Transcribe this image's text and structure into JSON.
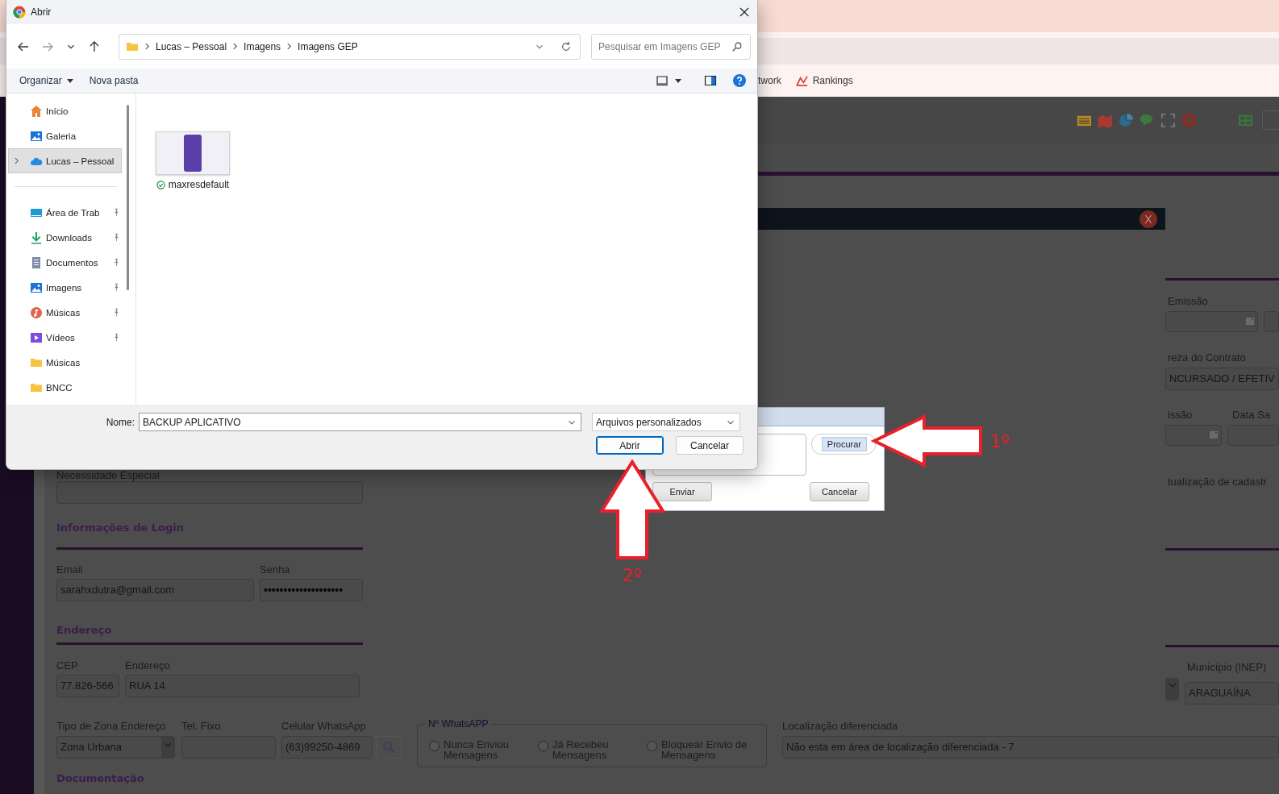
{
  "browser": {
    "bookmarks": [
      {
        "label": "twork",
        "kind": "plain"
      },
      {
        "label": "Rankings",
        "kind": "chart"
      }
    ]
  },
  "modal": {
    "close_label": "X"
  },
  "form": {
    "special_needs_label": "Necessidade Especial",
    "login": {
      "heading": "Informações de Login",
      "email_label": "Email",
      "email": "sarahxdutra@gmail.com",
      "password_label": "Senha",
      "password_mask": "••••••••••••••••••••"
    },
    "address": {
      "heading": "Endereço",
      "cep_label": "CEP",
      "cep": "77.826-566",
      "street_label": "Endereço",
      "street": "RUA 14"
    },
    "contact": {
      "zone_label": "Tipo de Zona Endereço",
      "zone": "Zona Urbana",
      "phone_label": "Tel. Fixo",
      "mobile_label": "Celular WhatsApp",
      "mobile": "(63)99250-4869"
    },
    "whatsapp": {
      "legend": "Nº WhatsAPP",
      "options": [
        {
          "label": "Nunca Enviou Mensagens",
          "selected": false
        },
        {
          "label": "Já Recebeu Mensagens",
          "selected": false
        },
        {
          "label": "Bloquear Envio de Mensagens",
          "selected": false
        }
      ]
    },
    "location": {
      "label": "Localização diferenciada",
      "value": "Não esta em área de localização diferenciada - 7"
    },
    "documents_heading": "Documentação"
  },
  "right_column": {
    "issue_date_label": "Emissão",
    "contract_label": "reza do Contrato",
    "contract": "NCURSADO / EFETIV",
    "admission_label": "issão",
    "exit_label": "Data Sa",
    "update_label": "tualização de cadastr",
    "municipality_label": "Município (INEP)",
    "municipality": "ARAGUAÍNA"
  },
  "upload_dialog": {
    "browse_button": "Procurar",
    "send_button": "Enviar",
    "cancel_button": "Cancelar"
  },
  "open_dialog": {
    "title": "Abrir",
    "breadcrumb": [
      "Lucas – Pessoal",
      "Imagens",
      "Imagens GEP"
    ],
    "search_placeholder": "Pesquisar em Imagens GEP",
    "organize": "Organizar",
    "new_folder": "Nova pasta",
    "sidebar_groups": [
      {
        "items": [
          {
            "label": "Início",
            "kind": "home",
            "selected": false,
            "pinned": false,
            "expandable": false
          },
          {
            "label": "Galeria",
            "kind": "gallery",
            "selected": false,
            "pinned": false,
            "expandable": false
          },
          {
            "label": "Lucas – Pessoal",
            "kind": "cloud",
            "selected": true,
            "pinned": false,
            "expandable": true
          }
        ]
      },
      {
        "items": [
          {
            "label": "Área de Trab",
            "kind": "desktop",
            "selected": false,
            "pinned": true,
            "expandable": false
          },
          {
            "label": "Downloads",
            "kind": "download",
            "selected": false,
            "pinned": true,
            "expandable": false
          },
          {
            "label": "Documentos",
            "kind": "document",
            "selected": false,
            "pinned": true,
            "expandable": false
          },
          {
            "label": "Imagens",
            "kind": "pictures",
            "selected": false,
            "pinned": true,
            "expandable": false
          },
          {
            "label": "Músicas",
            "kind": "music",
            "selected": false,
            "pinned": true,
            "expandable": false
          },
          {
            "label": "Vídeos",
            "kind": "video",
            "selected": false,
            "pinned": true,
            "expandable": false
          },
          {
            "label": "Músicas",
            "kind": "folder",
            "selected": false,
            "pinned": false,
            "expandable": false
          },
          {
            "label": "BNCC",
            "kind": "folder",
            "selected": false,
            "pinned": false,
            "expandable": false
          }
        ]
      }
    ],
    "files": [
      {
        "name": "maxresdefault",
        "synced": true
      }
    ],
    "file_name_label": "Nome:",
    "file_name": "BACKUP APLICATIVO",
    "file_type": "Arquivos personalizados",
    "buttons": [
      {
        "label": "Abrir",
        "default": true
      },
      {
        "label": "Cancelar",
        "default": false
      }
    ]
  },
  "annotations": [
    {
      "label": "1º",
      "kind": "left"
    },
    {
      "label": "2º",
      "kind": "up"
    }
  ]
}
